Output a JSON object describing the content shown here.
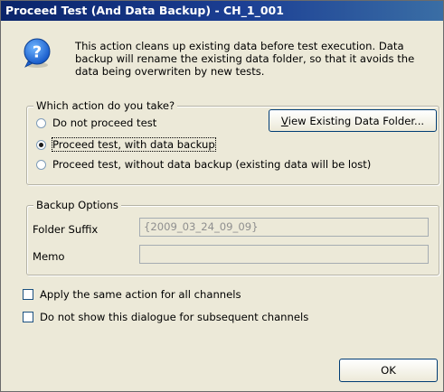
{
  "window": {
    "title": "Proceed Test (And Data Backup) - CH_1_001"
  },
  "info": {
    "icon": "question-icon",
    "text": "This action cleans up existing data before test execution. Data backup will rename the existing data folder, so that it avoids the data being overwriten by new tests."
  },
  "action_group": {
    "label": "Which action do you take?",
    "options": [
      {
        "label": "Do not proceed test",
        "selected": false
      },
      {
        "label": "Proceed test, with data backup",
        "selected": true
      },
      {
        "label": "Proceed test, without data backup (existing data will be lost)",
        "selected": false
      }
    ],
    "view_button": {
      "mnemonic": "V",
      "rest": "iew Existing Data Folder..."
    }
  },
  "backup_group": {
    "label": "Backup Options",
    "folder_suffix_label": "Folder Suffix",
    "folder_suffix_value": "{2009_03_24_09_09}",
    "memo_label": "Memo",
    "memo_value": ""
  },
  "checkboxes": [
    {
      "label": "Apply the same action for all channels",
      "checked": false
    },
    {
      "label": "Do not show this dialogue for subsequent channels",
      "checked": false
    }
  ],
  "ok_label": "OK",
  "colors": {
    "title_bar": "#0a246a",
    "dialog_bg": "#ece9d8",
    "button_border": "#003c74"
  }
}
